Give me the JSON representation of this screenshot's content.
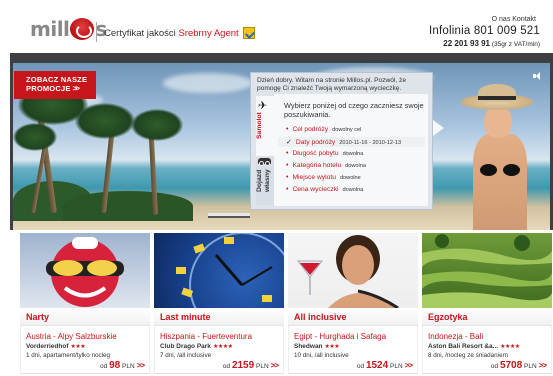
{
  "header": {
    "logo_text_left": "mill",
    "logo_text_right": "s",
    "cert_prefix": "Certyfikat jakości",
    "cert_highlight": "Srebrny Agent",
    "contact_link": "O nas Kontakt",
    "hotline_label": "Infolinia 801 009 521",
    "hotline_phone": "22 201 93 91",
    "hotline_cost": "(35gr z VAT/min)"
  },
  "banner": {
    "promo_line1": "ZOBACZ NASZE",
    "promo_line2": "PROMOCJE",
    "promo_chevrons": ">>",
    "greeting": "Dzień dobry. Witam na stronie Millos.pl. Pozwól, że pomogę Ci znaleźć Twoją wymarzoną wycieczkę.",
    "search_intro": "Wybierz poniżej od czego zaczniesz swoje poszukiwania.",
    "tabs": [
      {
        "label": "Samolot"
      },
      {
        "label": "Dojazd własny"
      }
    ],
    "criteria": [
      {
        "bullet": "•",
        "label": "Cel podróży",
        "value": "dowolny cel"
      },
      {
        "bullet": "✓",
        "label": "Daty podróży",
        "value": "2010-11-16 - 2010-12-13"
      },
      {
        "bullet": "•",
        "label": "Długość pobytu",
        "value": "dowolna"
      },
      {
        "bullet": "•",
        "label": "Kategoria hotelu",
        "value": "dowolna"
      },
      {
        "bullet": "•",
        "label": "Miejsce wylotu",
        "value": "dowolne"
      },
      {
        "bullet": "•",
        "label": "Cena wycieczki",
        "value": "dowolna"
      }
    ]
  },
  "cards": [
    {
      "title": "Narty",
      "destination": "Austria - Alpy Salzburskie",
      "hotel": "Vorderriedhof",
      "stars": "★★★",
      "info": "1 dni, apartament/tylko nocleg",
      "price_prefix": "od",
      "price": "98",
      "currency": "PLN",
      "chev": ">>"
    },
    {
      "title": "Last minute",
      "destination": "Hiszpania - Fuerteventura",
      "hotel": "Club Drago Park",
      "stars": "★★★★",
      "info": "7 dni, /all inclusive",
      "price_prefix": "od",
      "price": "2159",
      "currency": "PLN",
      "chev": ">>"
    },
    {
      "title": "All inclusive",
      "destination": "Egipt - Hurghada i Safaga",
      "hotel": "Shedwan",
      "stars": "★★★",
      "info": "10 dni, /all inclusive",
      "price_prefix": "od",
      "price": "1524",
      "currency": "PLN",
      "chev": ">>"
    },
    {
      "title": "Egzotyka",
      "destination": "Indonezja - Bali",
      "hotel": "Aston Bali Resort &a...",
      "stars": "★★★★",
      "info": "8 dni, /nocleg ze śniadaniem",
      "price_prefix": "od",
      "price": "5708",
      "currency": "PLN",
      "chev": ">>"
    }
  ],
  "icons": {
    "plane": "plane-icon",
    "car": "car-icon",
    "speaker": "speaker-icon",
    "badge": "silver-agent-badge-icon"
  },
  "colors": {
    "brand_red": "#c8141b",
    "panel_bg": "#dfe4ea",
    "banner_frame": "#3d3f42"
  }
}
